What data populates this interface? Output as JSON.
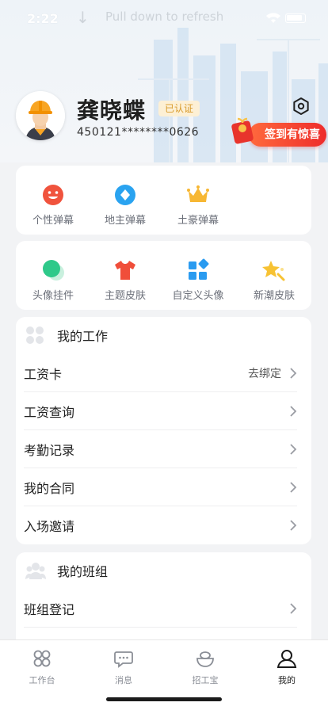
{
  "status_bar": {
    "time": "2:22",
    "pull_hint": "Pull down to refresh"
  },
  "profile": {
    "name": "龚晓蝶",
    "verified_badge": "已认证",
    "id_number": "450121********0626",
    "checkin_label": "签到有惊喜"
  },
  "barrage_grid": [
    {
      "label": "个性弹幕",
      "icon": "smile-face-icon",
      "color": "#f0533d"
    },
    {
      "label": "地主弹幕",
      "icon": "diamond-coin-icon",
      "color": "#2aa3f0"
    },
    {
      "label": "土豪弹幕",
      "icon": "crown-icon",
      "color": "#f7b733"
    }
  ],
  "decor_grid": [
    {
      "label": "头像挂件",
      "icon": "avatar-pendant-icon",
      "color": "#2fc98a"
    },
    {
      "label": "主题皮肤",
      "icon": "tshirt-icon",
      "color": "#f04e3a"
    },
    {
      "label": "自定义头像",
      "icon": "custom-avatar-icon",
      "color": "#2a9bf0"
    },
    {
      "label": "新潮皮肤",
      "icon": "sparkle-star-icon",
      "color": "#f7c233"
    }
  ],
  "work_section": {
    "title": "我的工作",
    "rows": [
      {
        "label": "工资卡",
        "value": "去绑定"
      },
      {
        "label": "工资查询",
        "value": ""
      },
      {
        "label": "考勤记录",
        "value": ""
      },
      {
        "label": "我的合同",
        "value": ""
      },
      {
        "label": "入场邀请",
        "value": ""
      }
    ]
  },
  "team_section": {
    "title": "我的班组",
    "rows": [
      {
        "label": "班组登记",
        "value": ""
      }
    ]
  },
  "tabbar": [
    {
      "label": "工作台",
      "icon": "workbench-icon",
      "active": false
    },
    {
      "label": "消息",
      "icon": "message-icon",
      "active": false
    },
    {
      "label": "招工宝",
      "icon": "recruit-icon",
      "active": false
    },
    {
      "label": "我的",
      "icon": "profile-icon",
      "active": true
    }
  ]
}
